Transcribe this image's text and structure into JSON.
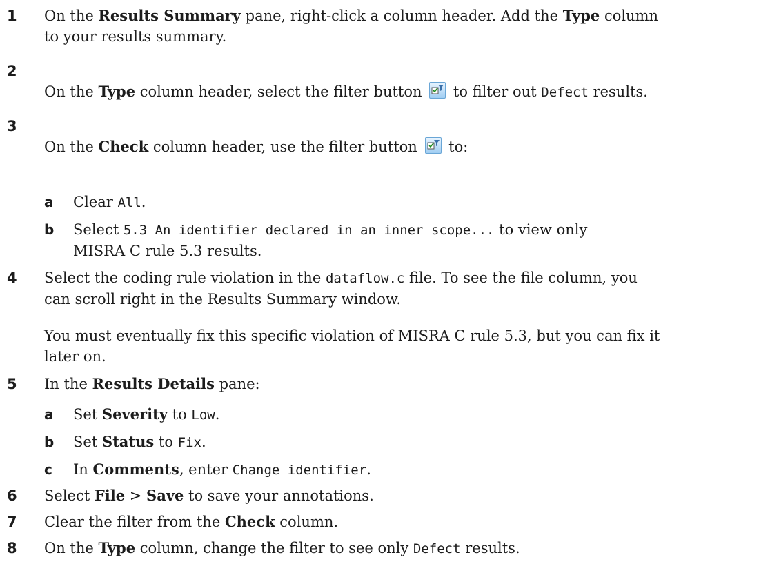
{
  "steps": [
    {
      "num": "1",
      "p1": "On the ",
      "b1": "Results Summary",
      "p2": " pane, right-click a column header. Add the ",
      "b2": "Type",
      "p3": " column",
      "line2": "to your results summary."
    },
    {
      "num": "2",
      "p1": "On the ",
      "b1": "Type",
      "p2": " column header, select the filter button ",
      "p3": " to filter out ",
      "m1": "Defect",
      "p4": " results."
    },
    {
      "num": "3",
      "p1": "On the ",
      "b1": "Check",
      "p2": " column header, use the filter button ",
      "p3": " to:",
      "subs": [
        {
          "letter": "a",
          "p1": "Clear ",
          "m1": "All",
          "p2": "."
        },
        {
          "letter": "b",
          "p1": "Select ",
          "m1": "5.3 An identifier declared in an inner scope...",
          "p2": " to view only",
          "line2": "MISRA C rule 5.3 results."
        }
      ]
    },
    {
      "num": "4",
      "p1": "Select the coding rule violation in the ",
      "m1": "dataflow.c",
      "p2": " file. To see the file column, you",
      "line2": "can scroll right in the Results Summary window.",
      "para2_l1": "You must eventually fix this specific violation of MISRA C rule 5.3, but you can fix it",
      "para2_l2": "later on."
    },
    {
      "num": "5",
      "p1": "In the ",
      "b1": "Results Details",
      "p2": " pane:",
      "subs": [
        {
          "letter": "a",
          "p1": "Set ",
          "b1": "Severity",
          "p2": " to ",
          "m1": "Low",
          "p3": "."
        },
        {
          "letter": "b",
          "p1": "Set ",
          "b1": "Status",
          "p2": " to ",
          "m1": "Fix",
          "p3": "."
        },
        {
          "letter": "c",
          "p1": "In ",
          "b1": "Comments",
          "p2": ", enter ",
          "m1": "Change identifier",
          "p3": "."
        }
      ]
    },
    {
      "num": "6",
      "p1": "Select ",
      "b1": "File",
      "p2": " > ",
      "b2": "Save",
      "p3": " to save your annotations."
    },
    {
      "num": "7",
      "p1": "Clear the filter from the ",
      "b1": "Check",
      "p2": " column."
    },
    {
      "num": "8",
      "p1": "On the ",
      "b1": "Type",
      "p2": " column, change the filter to see only ",
      "m1": "Defect",
      "p3": " results."
    }
  ],
  "icons": {
    "filter": "filter-button-icon"
  }
}
